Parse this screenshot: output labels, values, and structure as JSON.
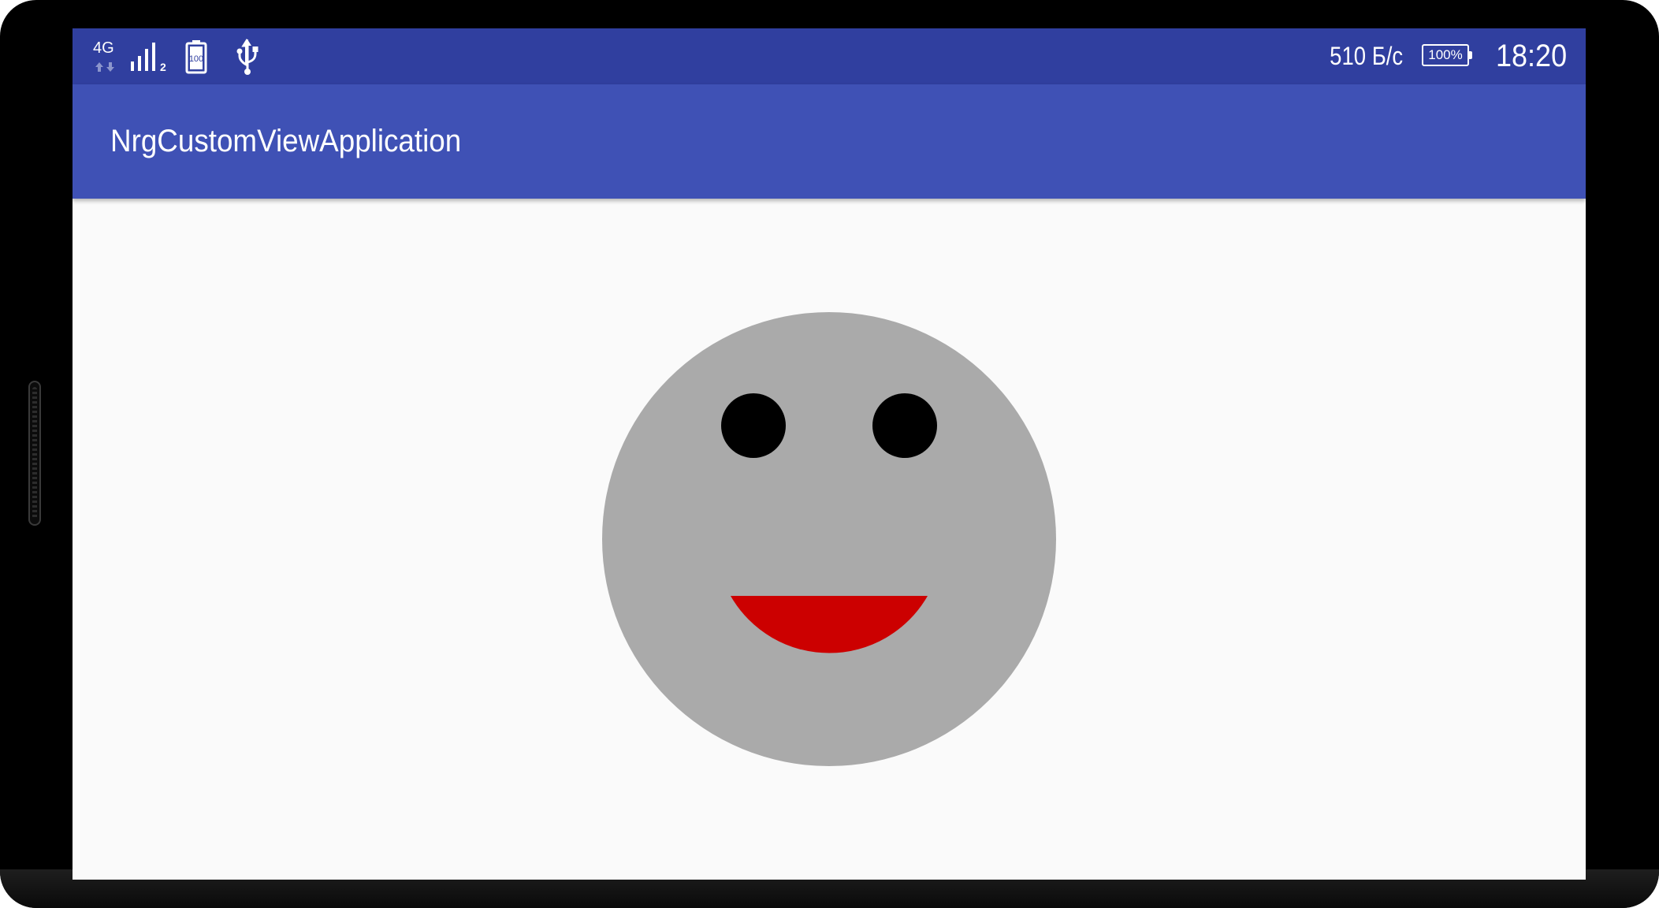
{
  "status_bar": {
    "network_type": "4G",
    "sim_index": "2",
    "battery_icon_level": "100",
    "net_speed": "510 Б/с",
    "battery_percent": "100%",
    "time": "18:20",
    "icons": [
      "network-4g-icon",
      "signal-strength-icon",
      "battery-icon",
      "usb-icon"
    ],
    "background_color": "#303f9f"
  },
  "app_bar": {
    "title": "NrgCustomViewApplication",
    "background_color": "#3f51b5"
  },
  "content": {
    "background_color": "#fafafa",
    "smiley": {
      "face_color": "#aaaaaa",
      "eye_color": "#000000",
      "mouth_color": "#cc0000"
    }
  }
}
